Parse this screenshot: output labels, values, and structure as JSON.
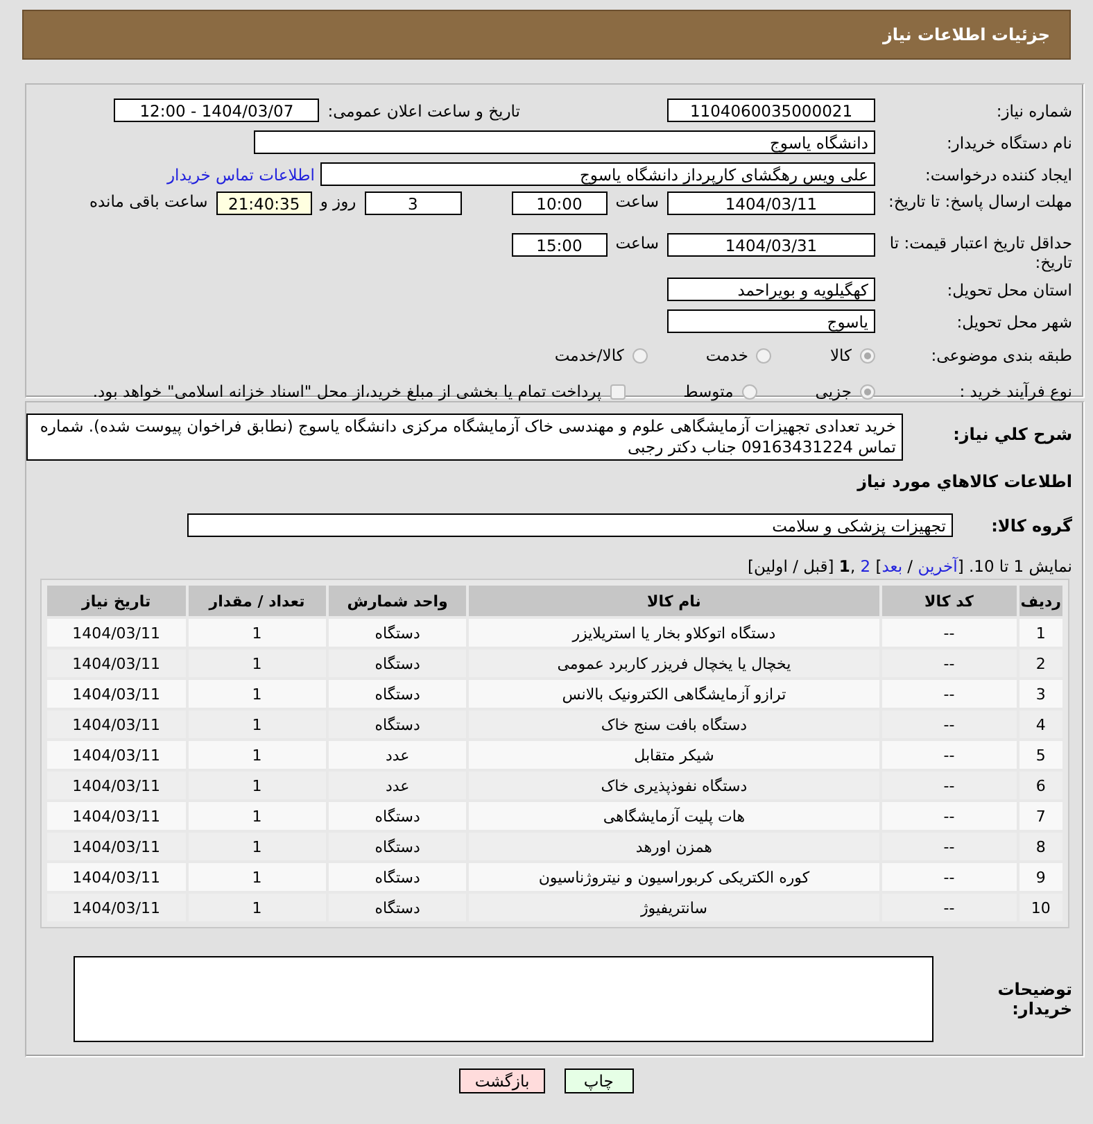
{
  "header": {
    "title": "جزئیات اطلاعات نیاز"
  },
  "need_number": {
    "label": "شماره نیاز:",
    "value": "1104060035000021"
  },
  "announce": {
    "label": "تاریخ و ساعت اعلان عمومی:",
    "value": "1404/03/07 - 12:00"
  },
  "buyer": {
    "label": "نام دستگاه خریدار:",
    "value": "دانشگاه یاسوج"
  },
  "requester": {
    "label": "ایجاد کننده درخواست:",
    "value": "علی ویس رهگشای کارپرداز دانشگاه یاسوج",
    "link": "اطلاعات تماس خریدار"
  },
  "deadline": {
    "label": "مهلت ارسال پاسخ: تا تاریخ:",
    "date": "1404/03/11",
    "time_label": "ساعت",
    "time": "10:00",
    "days": "3",
    "days_label": "روز و",
    "remaining": "21:40:35",
    "remaining_label": "ساعت باقی مانده"
  },
  "validity": {
    "label": "حداقل تاریخ اعتبار قیمت: تا تاریخ:",
    "date": "1404/03/31",
    "time_label": "ساعت",
    "time": "15:00"
  },
  "province": {
    "label": "استان محل تحویل:",
    "value": "کهگیلویه و بویراحمد"
  },
  "city": {
    "label": "شهر محل تحویل:",
    "value": "یاسوج"
  },
  "category": {
    "label": "طبقه بندی موضوعی:",
    "options": [
      {
        "label": "کالا",
        "selected": true
      },
      {
        "label": "خدمت",
        "selected": false
      },
      {
        "label": "کالا/خدمت",
        "selected": false
      }
    ]
  },
  "process": {
    "label": "نوع فرآیند خرید :",
    "options": [
      {
        "label": "جزیی",
        "selected": true
      },
      {
        "label": "متوسط",
        "selected": false
      }
    ],
    "checkbox": {
      "label": "پرداخت تمام یا بخشی از مبلغ خرید،از محل \"اسناد خزانه اسلامی\" خواهد بود.",
      "checked": false
    }
  },
  "description": {
    "label": "شرح کلي نياز:",
    "value": "خرید تعدادی تجهیزات آزمایشگاهی علوم و مهندسی خاک آزمایشگاه مرکزی دانشگاه یاسوج (نطابق فراخوان پیوست شده). شماره تماس 09163431224 جناب دکتر رجبی"
  },
  "items_title": "اطلاعات کالاهاي مورد نياز",
  "group": {
    "label": "گروه کالا:",
    "value": "تجهیزات پزشکی و سلامت"
  },
  "pagination": [
    {
      "kind": "text",
      "text": "نمایش 1 تا 10. ["
    },
    {
      "kind": "link",
      "text": "آخرین"
    },
    {
      "kind": "text",
      "text": " / "
    },
    {
      "kind": "link",
      "text": "بعد"
    },
    {
      "kind": "text",
      "text": "] "
    },
    {
      "kind": "link",
      "text": "2"
    },
    {
      "kind": "text",
      "text": " ,"
    },
    {
      "kind": "current",
      "text": "1"
    },
    {
      "kind": "text",
      "text": " [قبل / اولین]"
    }
  ],
  "table": {
    "columns": [
      "ردیف",
      "کد کالا",
      "نام کالا",
      "واحد شمارش",
      "تعداد / مقدار",
      "تاریخ نیاز"
    ],
    "rows": [
      [
        "1",
        "--",
        "دستگاه اتوکلاو بخار یا استریلایزر",
        "دستگاه",
        "1",
        "1404/03/11"
      ],
      [
        "2",
        "--",
        "یخچال یا یخچال فریزر کاربرد عمومی",
        "دستگاه",
        "1",
        "1404/03/11"
      ],
      [
        "3",
        "--",
        "ترازو آزمایشگاهی الکترونیک بالانس",
        "دستگاه",
        "1",
        "1404/03/11"
      ],
      [
        "4",
        "--",
        "دستگاه بافت سنج خاک",
        "دستگاه",
        "1",
        "1404/03/11"
      ],
      [
        "5",
        "--",
        "شیکر متقابل",
        "عدد",
        "1",
        "1404/03/11"
      ],
      [
        "6",
        "--",
        "دستگاه نفوذپذیری خاک",
        "عدد",
        "1",
        "1404/03/11"
      ],
      [
        "7",
        "--",
        "هات پلیت آزمایشگاهی",
        "دستگاه",
        "1",
        "1404/03/11"
      ],
      [
        "8",
        "--",
        "همزن اورهد",
        "دستگاه",
        "1",
        "1404/03/11"
      ],
      [
        "9",
        "--",
        "کوره الکتریکی کربوراسیون و نیتروژناسیون",
        "دستگاه",
        "1",
        "1404/03/11"
      ],
      [
        "10",
        "--",
        "سانتریفیوژ",
        "دستگاه",
        "1",
        "1404/03/11"
      ]
    ]
  },
  "notes": {
    "label": "توضیحات خریدار:"
  },
  "buttons": [
    {
      "kind": "print",
      "label": "چاپ"
    },
    {
      "kind": "back",
      "label": "بازگشت"
    }
  ]
}
